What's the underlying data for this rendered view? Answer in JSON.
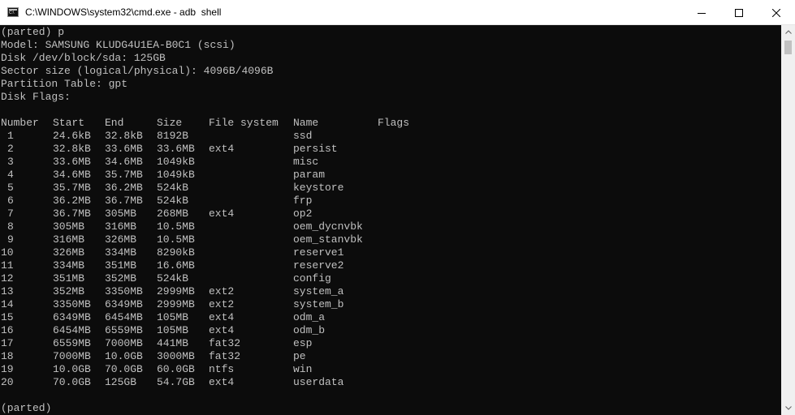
{
  "window": {
    "title": "C:\\WINDOWS\\system32\\cmd.exe - adb  shell",
    "icon": "cmd-console-icon"
  },
  "controls": {
    "minimize_icon": "minimize-icon",
    "maximize_icon": "maximize-icon",
    "close_icon": "close-icon"
  },
  "terminal": {
    "header_lines": [
      "(parted) p",
      "Model: SAMSUNG KLUDG4U1EA-B0C1 (scsi)",
      "Disk /dev/block/sda: 125GB",
      "Sector size (logical/physical): 4096B/4096B",
      "Partition Table: gpt",
      "Disk Flags:"
    ],
    "columns": [
      "Number",
      "Start",
      "End",
      "Size",
      "File system",
      "Name",
      "Flags"
    ],
    "partitions": [
      [
        "1",
        "24.6kB",
        "32.8kB",
        "8192B",
        "",
        "ssd",
        ""
      ],
      [
        "2",
        "32.8kB",
        "33.6MB",
        "33.6MB",
        "ext4",
        "persist",
        ""
      ],
      [
        "3",
        "33.6MB",
        "34.6MB",
        "1049kB",
        "",
        "misc",
        ""
      ],
      [
        "4",
        "34.6MB",
        "35.7MB",
        "1049kB",
        "",
        "param",
        ""
      ],
      [
        "5",
        "35.7MB",
        "36.2MB",
        "524kB",
        "",
        "keystore",
        ""
      ],
      [
        "6",
        "36.2MB",
        "36.7MB",
        "524kB",
        "",
        "frp",
        ""
      ],
      [
        "7",
        "36.7MB",
        "305MB",
        "268MB",
        "ext4",
        "op2",
        ""
      ],
      [
        "8",
        "305MB",
        "316MB",
        "10.5MB",
        "",
        "oem_dycnvbk",
        ""
      ],
      [
        "9",
        "316MB",
        "326MB",
        "10.5MB",
        "",
        "oem_stanvbk",
        ""
      ],
      [
        "10",
        "326MB",
        "334MB",
        "8290kB",
        "",
        "reserve1",
        ""
      ],
      [
        "11",
        "334MB",
        "351MB",
        "16.6MB",
        "",
        "reserve2",
        ""
      ],
      [
        "12",
        "351MB",
        "352MB",
        "524kB",
        "",
        "config",
        ""
      ],
      [
        "13",
        "352MB",
        "3350MB",
        "2999MB",
        "ext2",
        "system_a",
        ""
      ],
      [
        "14",
        "3350MB",
        "6349MB",
        "2999MB",
        "ext2",
        "system_b",
        ""
      ],
      [
        "15",
        "6349MB",
        "6454MB",
        "105MB",
        "ext4",
        "odm_a",
        ""
      ],
      [
        "16",
        "6454MB",
        "6559MB",
        "105MB",
        "ext4",
        "odm_b",
        ""
      ],
      [
        "17",
        "6559MB",
        "7000MB",
        "441MB",
        "fat32",
        "esp",
        ""
      ],
      [
        "18",
        "7000MB",
        "10.0GB",
        "3000MB",
        "fat32",
        "pe",
        ""
      ],
      [
        "19",
        "10.0GB",
        "70.0GB",
        "60.0GB",
        "ntfs",
        "win",
        ""
      ],
      [
        "20",
        "70.0GB",
        "125GB",
        "54.7GB",
        "ext4",
        "userdata",
        ""
      ]
    ],
    "prompt": "(parted)",
    "colors": {
      "background": "#0c0c0c",
      "foreground": "#c0c0c0"
    }
  },
  "scrollbar": {
    "up_icon": "scroll-up-arrow-icon",
    "down_icon": "scroll-down-arrow-icon"
  }
}
